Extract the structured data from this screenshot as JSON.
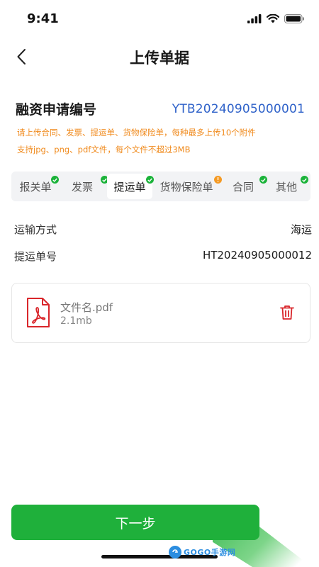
{
  "status_bar": {
    "time": "9:41"
  },
  "nav": {
    "title": "上传单据",
    "back_icon": "chevron-left-icon"
  },
  "application": {
    "label": "融资申请编号",
    "number": "YTB20240905000001"
  },
  "tips": [
    "请上传合同、发票、提运单、货物保险单，每种最多上传10个附件",
    "支持jpg、png、pdf文件，每个文件不超过3MB"
  ],
  "tabs": [
    {
      "label": "报关单",
      "status": "done"
    },
    {
      "label": "发票",
      "status": "done"
    },
    {
      "label": "提运单",
      "status": "done",
      "active": true
    },
    {
      "label": "货物保险单",
      "status": "warning"
    },
    {
      "label": "合同",
      "status": "done"
    },
    {
      "label": "其他",
      "status": "done"
    }
  ],
  "details": {
    "transport": {
      "label": "运输方式",
      "value": "海运"
    },
    "bill_no": {
      "label": "提运单号",
      "value": "HT20240905000012"
    }
  },
  "file": {
    "name": "文件名.pdf",
    "size": "2.1mb",
    "icon": "pdf-file-icon",
    "delete_icon": "trash-icon"
  },
  "actions": {
    "next_label": "下一步"
  },
  "watermark": {
    "text": "GOGO手游网"
  },
  "colors": {
    "primary": "#1fb03b",
    "link_blue": "#2f62c9",
    "tip_orange": "#f08a1c",
    "danger": "#d9262b",
    "warning": "#f59a23"
  }
}
